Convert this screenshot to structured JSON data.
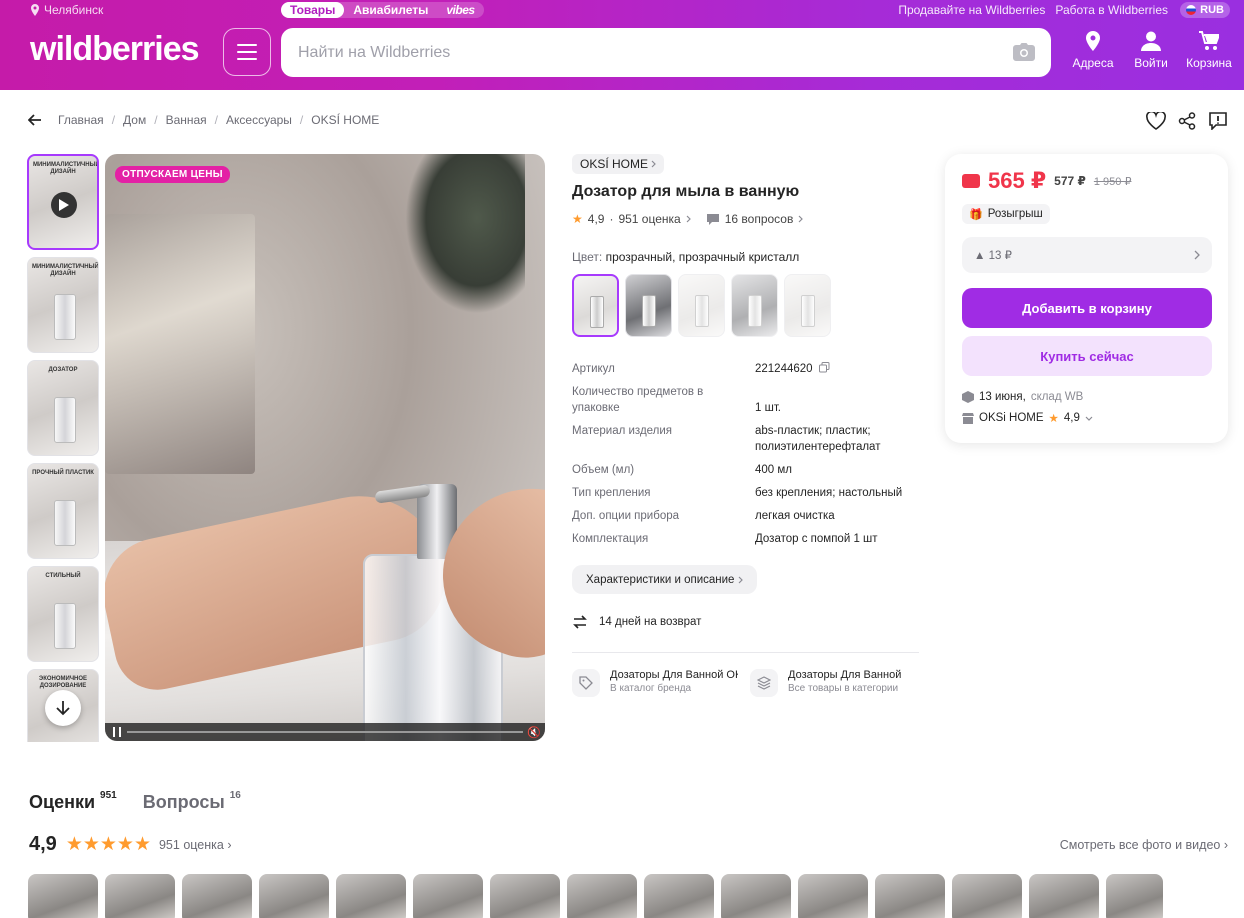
{
  "header": {
    "city": "Челябинск",
    "tabs": [
      "Товары",
      "Авиабилеты",
      "vibes"
    ],
    "links": [
      "Продавайте на Wildberries",
      "Работа в Wildberries"
    ],
    "currency": "RUB",
    "logo": "wildberries",
    "search_placeholder": "Найти на Wildberries",
    "icons": [
      {
        "label": "Адреса",
        "icon": "location-pin-icon"
      },
      {
        "label": "Войти",
        "icon": "user-icon"
      },
      {
        "label": "Корзина",
        "icon": "cart-icon"
      }
    ]
  },
  "breadcrumbs": [
    "Главная",
    "Дом",
    "Ванная",
    "Аксессуары",
    "OKSÍ HOME"
  ],
  "gallery": {
    "badge": "ОТПУСКАЕМ ЦЕНЫ",
    "thumb_labels": [
      "МИНИМАЛИСТИЧНЫЙ ДИЗАЙН",
      "МИНИМАЛИСТИЧНЫЙ ДИЗАЙН",
      "ДОЗАТОР",
      "ПРОЧНЫЙ ПЛАСТИК",
      "СТИЛЬНЫЙ",
      "ЭКОНОМИЧНОЕ ДОЗИРОВАНИЕ"
    ]
  },
  "product": {
    "brand": "OKSÍ HOME",
    "title": "Дозатор для мыла в ванную",
    "rating": "4,9",
    "reviews": "951 оценка",
    "questions": "16 вопросов",
    "color_label": "Цвет:",
    "color_value": "прозрачный, прозрачный кристалл",
    "specs": [
      {
        "k": "Артикул",
        "v": "221244620"
      },
      {
        "k": "Количество предметов в упаковке",
        "v": "1 шт."
      },
      {
        "k": "Материал изделия",
        "v": "abs-пластик; пластик; полиэтилентерефталат"
      },
      {
        "k": "Объем (мл)",
        "v": "400 мл"
      },
      {
        "k": "Тип крепления",
        "v": "без крепления; настольный"
      },
      {
        "k": "Доп. опции прибора",
        "v": "легкая очистка"
      },
      {
        "k": "Комплектация",
        "v": "Дозатор с помпой 1 шт"
      }
    ],
    "more_button": "Характеристики и описание",
    "returns": "14 дней на возврат",
    "link_cards": [
      {
        "title": "Дозаторы Для Ванной OKSÍ HOME",
        "sub": "В каталог бренда"
      },
      {
        "title": "Дозаторы Для Ванной",
        "sub": "Все товары в категории"
      }
    ]
  },
  "price_card": {
    "price": "565 ₽",
    "price_mid": "577 ₽",
    "price_old": "1 950 ₽",
    "lottery": "Розыгрыш",
    "delta": "13 ₽",
    "add_to_cart": "Добавить в корзину",
    "buy_now": "Купить сейчас",
    "delivery_date": "13 июня,",
    "delivery_place": "склад WB",
    "seller": "OKSi HOME",
    "seller_rating": "4,9"
  },
  "reviews": {
    "tab_reviews": "Оценки",
    "tab_reviews_count": "951",
    "tab_questions": "Вопросы",
    "tab_questions_count": "16",
    "rating": "4,9",
    "count": "951 оценка",
    "see_all": "Смотреть все фото и видео"
  },
  "colors": {
    "accent": "#a02ce4",
    "price": "#f0354a",
    "star": "#ff9b2e",
    "badge": "#e321a5"
  }
}
